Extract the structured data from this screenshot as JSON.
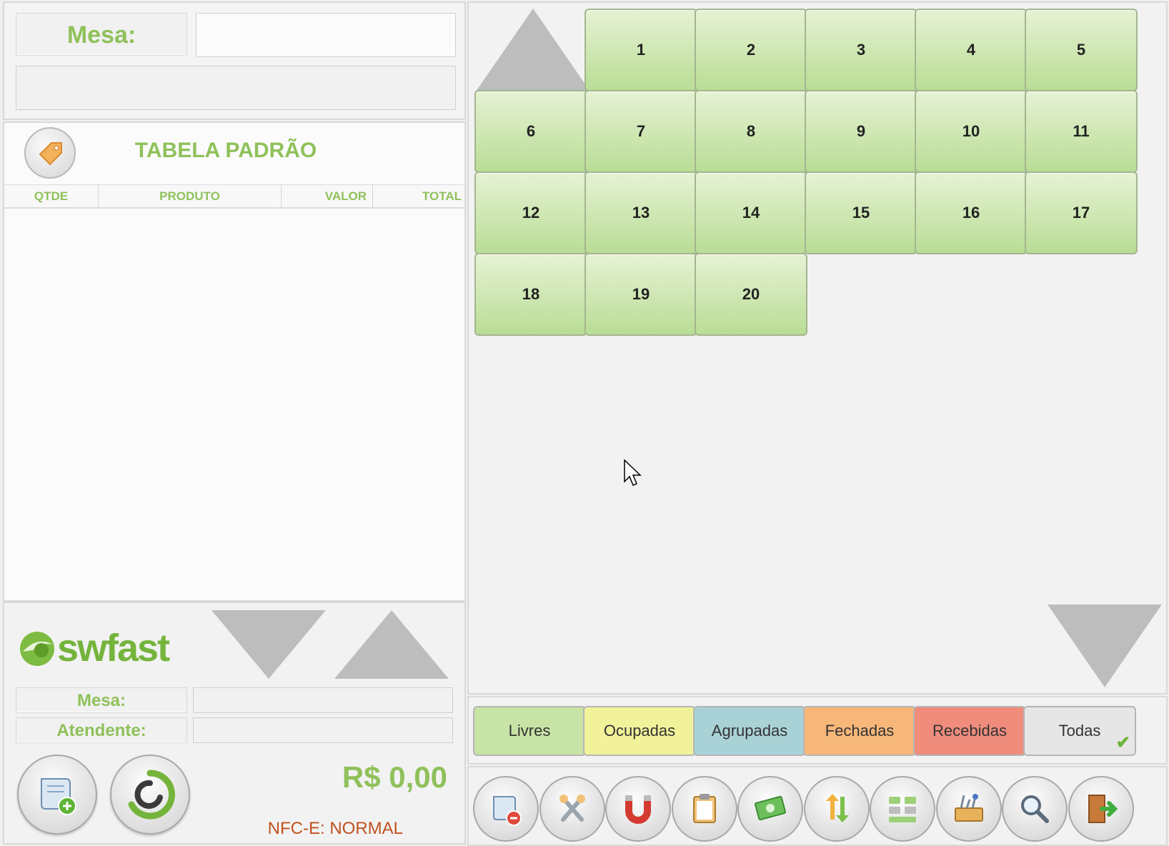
{
  "order": {
    "mesa_label": "Mesa:",
    "mesa_value": "",
    "info": ""
  },
  "price_table": {
    "icon": "price-tag-icon",
    "title": "TABELA PADRÃO"
  },
  "columns": {
    "qtde": "QTDE",
    "produto": "PRODUTO",
    "valor": "VALOR",
    "total": "TOTAL"
  },
  "items": [],
  "footer": {
    "logo_text": "swfast",
    "mesa_label": "Mesa:",
    "mesa_value": "",
    "atendente_label": "Atendente:",
    "atendente_value": "",
    "total": "R$ 0,00",
    "nfce_status": "NFC-E: NORMAL"
  },
  "tables": [
    "1",
    "2",
    "3",
    "4",
    "5",
    "6",
    "7",
    "8",
    "9",
    "10",
    "11",
    "12",
    "13",
    "14",
    "15",
    "16",
    "17",
    "18",
    "19",
    "20"
  ],
  "filters": [
    {
      "label": "Livres",
      "color": "#c7e3a6"
    },
    {
      "label": "Ocupadas",
      "color": "#f2f29a"
    },
    {
      "label": "Agrupadas",
      "color": "#a9d2d6"
    },
    {
      "label": "Fechadas",
      "color": "#f6b779"
    },
    {
      "label": "Recebidas",
      "color": "#ef8c7c"
    },
    {
      "label": "Todas",
      "color": "#e6e6e6",
      "selected": true
    }
  ],
  "toolbar": [
    "remove-order-icon",
    "cutlery-icon",
    "magnet-icon",
    "clipboard-icon",
    "money-icon",
    "transfer-icon",
    "group-tables-icon",
    "toolbox-icon",
    "search-icon",
    "exit-icon"
  ],
  "colors": {
    "accent_green": "#8fc15a",
    "table_green": "#c3e2a1",
    "nfce_orange": "#c0521f"
  }
}
